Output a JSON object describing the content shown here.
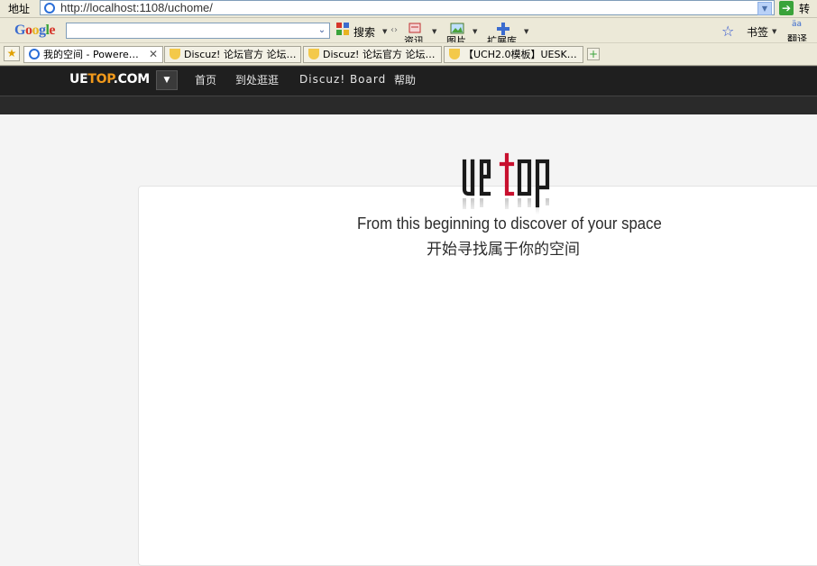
{
  "browser": {
    "address_label": "地址",
    "url": "http://localhost:1108/uchome/",
    "go_label": "转到",
    "google": {
      "logo": "Google",
      "search_label": "搜索",
      "news_label": "资讯",
      "images_label": "图片",
      "extensions_label": "扩展库",
      "bookmarks_label": "书签",
      "translate_label": "翻译"
    },
    "tabs": [
      {
        "title": "我的空间 - Powere…",
        "active": true
      },
      {
        "title": "Discuz! 论坛官方 论坛…",
        "active": false
      },
      {
        "title": "Discuz! 论坛官方 论坛…",
        "active": false
      },
      {
        "title": "【UCH2.0模板】UESK…",
        "active": false
      }
    ]
  },
  "site": {
    "logo_part1": "UE",
    "logo_part2": "TOP",
    "logo_part3": ".COM",
    "nav": [
      "首页",
      "到处逛逛",
      "Discuz! Board",
      "帮助"
    ]
  },
  "main": {
    "logo_text": "uetop",
    "tagline_en": "From this beginning to discover of your space",
    "tagline_cn": "开始寻找属于你的空间"
  },
  "colors": {
    "accent_orange": "#f29a1b",
    "logo_red": "#c8102e",
    "nav_bg": "#1f1f1f"
  }
}
